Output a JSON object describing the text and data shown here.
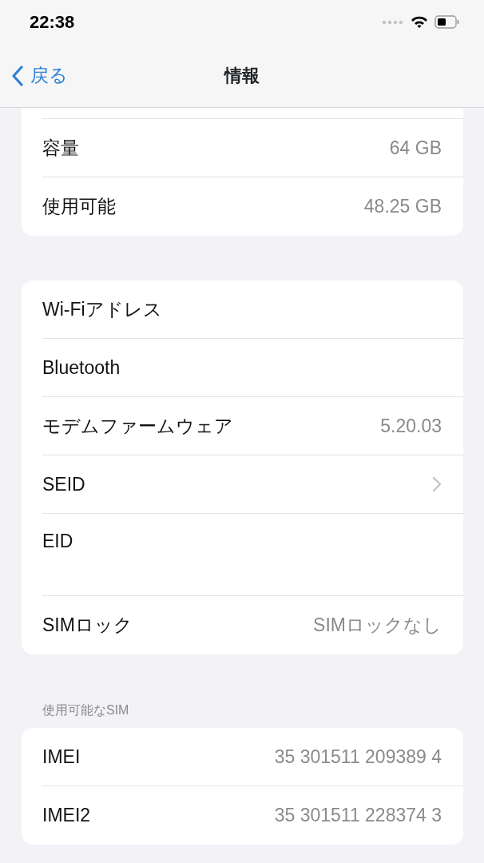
{
  "status_bar": {
    "time": "22:38"
  },
  "nav": {
    "back": "戻る",
    "title": "情報"
  },
  "groups": [
    {
      "cut_top": true,
      "rows": [
        {
          "kind": "detail",
          "label": "容量",
          "value": "64 GB"
        },
        {
          "kind": "detail",
          "label": "使用可能",
          "value": "48.25 GB"
        }
      ]
    },
    {
      "cut_top": false,
      "rows": [
        {
          "kind": "detail",
          "label": "Wi-Fiアドレス"
        },
        {
          "kind": "detail",
          "label": "Bluetooth"
        },
        {
          "kind": "detail",
          "label": "モデムファームウェア",
          "value": "5.20.03"
        },
        {
          "kind": "link",
          "label": "SEID"
        },
        {
          "kind": "tall",
          "label": "EID"
        },
        {
          "kind": "detail",
          "label": "SIMロック",
          "value": "SIMロックなし"
        }
      ]
    },
    {
      "cut_top": false,
      "header": "使用可能なSIM",
      "rows": [
        {
          "kind": "detail",
          "label": "IMEI",
          "value": "35 301511 209389 4"
        },
        {
          "kind": "detail",
          "label": "IMEI2",
          "value": "35 301511 228374 3"
        }
      ]
    }
  ]
}
